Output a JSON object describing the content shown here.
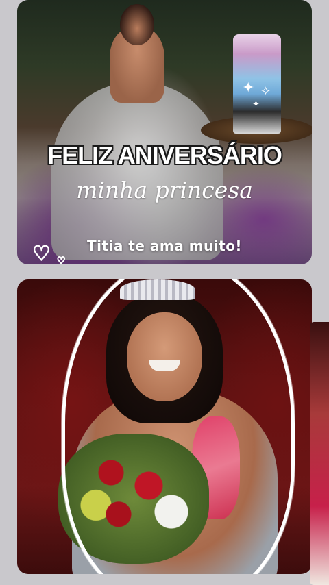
{
  "top_card": {
    "headline": "FELIZ ANIVERSÁRIO",
    "script_line": "minha princesa",
    "tagline": "Titia te ama muito!",
    "decorations": [
      "sparkle-icon",
      "heart-icon"
    ]
  },
  "bottom_card": {
    "decorations": [
      "sticker-outline"
    ]
  },
  "colors": {
    "page_background": "#c9c8cc",
    "text": "#ffffff",
    "headline_outline": "#1a1a1a"
  }
}
